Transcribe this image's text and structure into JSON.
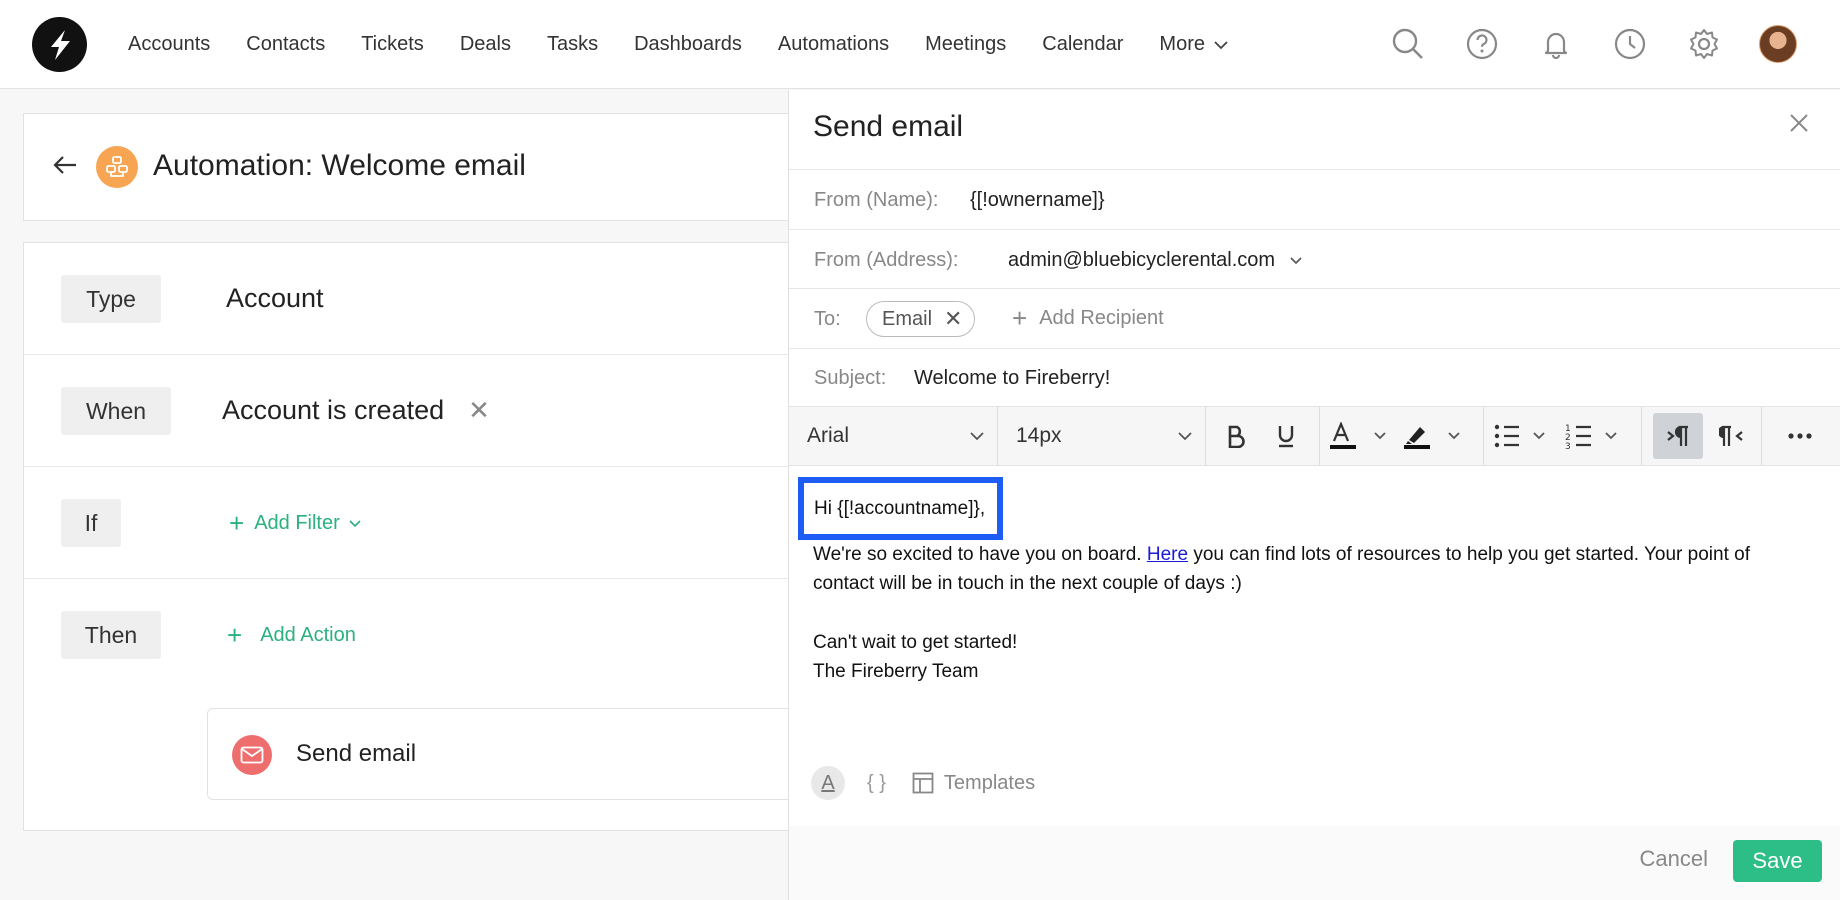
{
  "nav": {
    "items": [
      "Accounts",
      "Contacts",
      "Tickets",
      "Deals",
      "Tasks",
      "Dashboards",
      "Automations",
      "Meetings",
      "Calendar"
    ],
    "more_label": "More"
  },
  "automation": {
    "title": "Automation: Welcome email",
    "rules": {
      "type_label": "Type",
      "type_value": "Account",
      "when_label": "When",
      "when_value": "Account is created",
      "if_label": "If",
      "add_filter": "Add Filter",
      "then_label": "Then",
      "add_action": "Add Action"
    },
    "action": {
      "label": "Send email"
    }
  },
  "email": {
    "title": "Send email",
    "from_name_label": "From (Name):",
    "from_name_value": "{[!ownername]}",
    "from_address_label": "From (Address):",
    "from_address_value": "admin@bluebicyclerental.com",
    "to_label": "To:",
    "to_chip": "Email",
    "add_recipient": "Add Recipient",
    "subject_label": "Subject:",
    "subject_value": "Welcome to Fireberry!",
    "toolbar": {
      "font": "Arial",
      "size": "14px"
    },
    "body": {
      "greeting": "Hi {[!accountname]},",
      "line1_pre": "We're so excited to have you on board. ",
      "link": "Here",
      "line1_post": " you can find lots of resources to help you get started. Your point of contact will be in touch in the next couple of days :)",
      "line2": "Can't wait to get started!",
      "line3": "The Fireberry Team"
    },
    "footer_tools": {
      "braces": "{ }",
      "templates": "Templates",
      "format": "A"
    },
    "cancel": "Cancel",
    "save": "Save"
  },
  "colors": {
    "accent_green": "#2dbd87",
    "highlight_blue": "#1e5cf6",
    "automation_orange": "#f7a552",
    "email_red": "#ee6e6e"
  }
}
